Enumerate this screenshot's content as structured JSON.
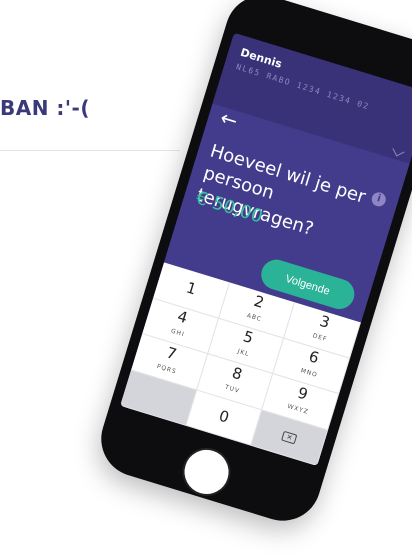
{
  "background": {
    "heading": "BAN :'-("
  },
  "account": {
    "name": "Dennis",
    "iban": "NL65 RABO 1234 1234 02"
  },
  "main": {
    "back_icon": "arrow-left",
    "question": "Hoeveel wil je per persoon terugvragen?",
    "amount": "€ 50,00",
    "next_label": "Volgende"
  },
  "keypad": [
    {
      "digit": "1",
      "letters": ""
    },
    {
      "digit": "2",
      "letters": "ABC"
    },
    {
      "digit": "3",
      "letters": "DEF"
    },
    {
      "digit": "4",
      "letters": "GHI"
    },
    {
      "digit": "5",
      "letters": "JKL"
    },
    {
      "digit": "6",
      "letters": "MNO"
    },
    {
      "digit": "7",
      "letters": "PQRS"
    },
    {
      "digit": "8",
      "letters": "TUV"
    },
    {
      "digit": "9",
      "letters": "WXYZ"
    },
    {
      "digit": "",
      "letters": ""
    },
    {
      "digit": "0",
      "letters": ""
    },
    {
      "digit": "backspace",
      "letters": ""
    }
  ],
  "colors": {
    "primary": "#433c8c",
    "accent": "#2ab396",
    "amount": "#35c2a1"
  }
}
